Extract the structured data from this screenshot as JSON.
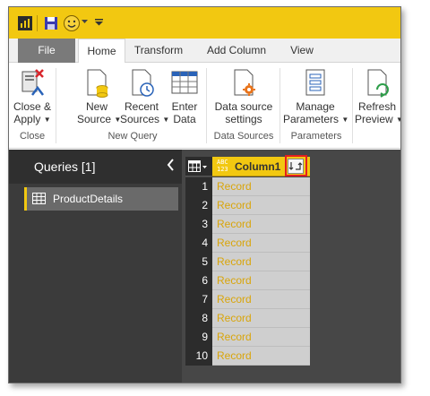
{
  "app": {
    "accent_color": "#f2c811",
    "quick_access": [
      "powerbi-logo-icon",
      "save-icon",
      "smiley-icon",
      "dropdown-icon"
    ]
  },
  "tabs": [
    {
      "label": "File"
    },
    {
      "label": "Home",
      "active": true
    },
    {
      "label": "Transform"
    },
    {
      "label": "Add Column"
    },
    {
      "label": "View"
    }
  ],
  "ribbon": {
    "close_apply": {
      "line1": "Close &",
      "line2": "Apply"
    },
    "new_source": {
      "line1": "New",
      "line2": "Source"
    },
    "recent_sources": {
      "line1": "Recent",
      "line2": "Sources"
    },
    "enter_data": {
      "line1": "Enter",
      "line2": "Data"
    },
    "data_source_settings": {
      "line1": "Data source",
      "line2": "settings"
    },
    "manage_parameters": {
      "line1": "Manage",
      "line2": "Parameters"
    },
    "refresh_preview": {
      "line1": "Refresh",
      "line2": "Preview"
    },
    "groups": {
      "close": "Close",
      "new_query": "New Query",
      "data_sources": "Data Sources",
      "parameters": "Parameters"
    }
  },
  "queries": {
    "title": "Queries [1]",
    "items": [
      {
        "label": "ProductDetails"
      }
    ]
  },
  "grid": {
    "column_name": "Column1",
    "column_type": "ABC\n123",
    "rows": [
      {
        "num": "1",
        "value": "Record"
      },
      {
        "num": "2",
        "value": "Record"
      },
      {
        "num": "3",
        "value": "Record"
      },
      {
        "num": "4",
        "value": "Record"
      },
      {
        "num": "5",
        "value": "Record"
      },
      {
        "num": "6",
        "value": "Record"
      },
      {
        "num": "7",
        "value": "Record"
      },
      {
        "num": "8",
        "value": "Record"
      },
      {
        "num": "9",
        "value": "Record"
      },
      {
        "num": "10",
        "value": "Record"
      }
    ]
  }
}
